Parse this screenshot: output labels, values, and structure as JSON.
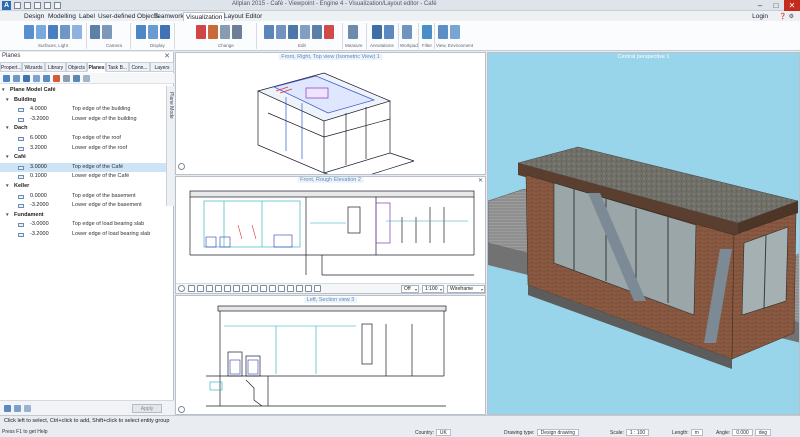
{
  "app": {
    "title": "Allplan 2015 - Café - Viewpoint - Engine 4 - Visualization/Layout editor - Café"
  },
  "menu": {
    "tabs": [
      "Design",
      "Modelling",
      "Label",
      "User-defined Objects",
      "Teamwork",
      "Visualization",
      "Layout Editor"
    ],
    "active_index": 5,
    "login": "Login"
  },
  "ribbon": {
    "groups": [
      "Surfaces, Light",
      "Camera",
      "Display",
      "Change",
      "Edit",
      "Measure",
      "Annotations",
      "Workpad",
      "Filter",
      "View, Environment"
    ]
  },
  "planes_panel": {
    "title": "Planes",
    "tabs": [
      "Propert...",
      "Wizards",
      "Library",
      "Objects",
      "Planes",
      "Task B...",
      "Conn...",
      "Layers"
    ],
    "active_tab": 4,
    "side_label": "Plane Mode",
    "apply_label": "Apply",
    "tree": {
      "root": "Plane Model Café",
      "groups": [
        {
          "name": "Building",
          "rows": [
            {
              "value": "4.0000",
              "desc": "Top edge of the building"
            },
            {
              "value": "-3.2000",
              "desc": "Lower edge of the building"
            }
          ]
        },
        {
          "name": "Dach",
          "rows": [
            {
              "value": "6.0000",
              "desc": "Top edge of the roof"
            },
            {
              "value": "3.2000",
              "desc": "Lower edge of the roof"
            }
          ]
        },
        {
          "name": "Café",
          "rows": [
            {
              "value": "3.0000",
              "desc": "Top edge of the Café",
              "selected": true
            },
            {
              "value": "0.1000",
              "desc": "Lower edge of the Café"
            }
          ]
        },
        {
          "name": "Keller",
          "rows": [
            {
              "value": "0.0000",
              "desc": "Top edge of the basement"
            },
            {
              "value": "-3.2000",
              "desc": "Lower edge of the basement"
            }
          ]
        },
        {
          "name": "Fundament",
          "rows": [
            {
              "value": "-3.0000",
              "desc": "Top edge of load bearing slab"
            },
            {
              "value": "-3.2000",
              "desc": "Lower edge of load bearing slab"
            }
          ]
        }
      ]
    }
  },
  "viewports": {
    "iso": {
      "title": "Front, Right, Top view (Isometric View) 1"
    },
    "elevation": {
      "title": "Front, Rough Elevation 2"
    },
    "section": {
      "title": "Left, Section view 3"
    },
    "perspective": {
      "title": "Central perspective 1"
    },
    "toolbar": {
      "select1": "Off",
      "select2": "1:100",
      "select3": "Wireframe"
    }
  },
  "status": {
    "message": "Click left to select, Ctrl+click to add, Shift+click to select entity group",
    "f1": "Press F1 to get Help",
    "country_label": "Country:",
    "country_value": "UK",
    "drawing_type_label": "Drawing type:",
    "drawing_type_value": "Design drawing",
    "scale_label": "Scale:",
    "scale_value": "1 : 100",
    "length_label": "Length:",
    "length_value": "m",
    "angle_label": "Angle:",
    "angle_value": "0.000",
    "unit_value": "deg"
  },
  "colors": {
    "accent": "#2b6cb0",
    "sky": "#98d4ea",
    "selection": "#cde4f7",
    "close": "#c42b1c"
  }
}
